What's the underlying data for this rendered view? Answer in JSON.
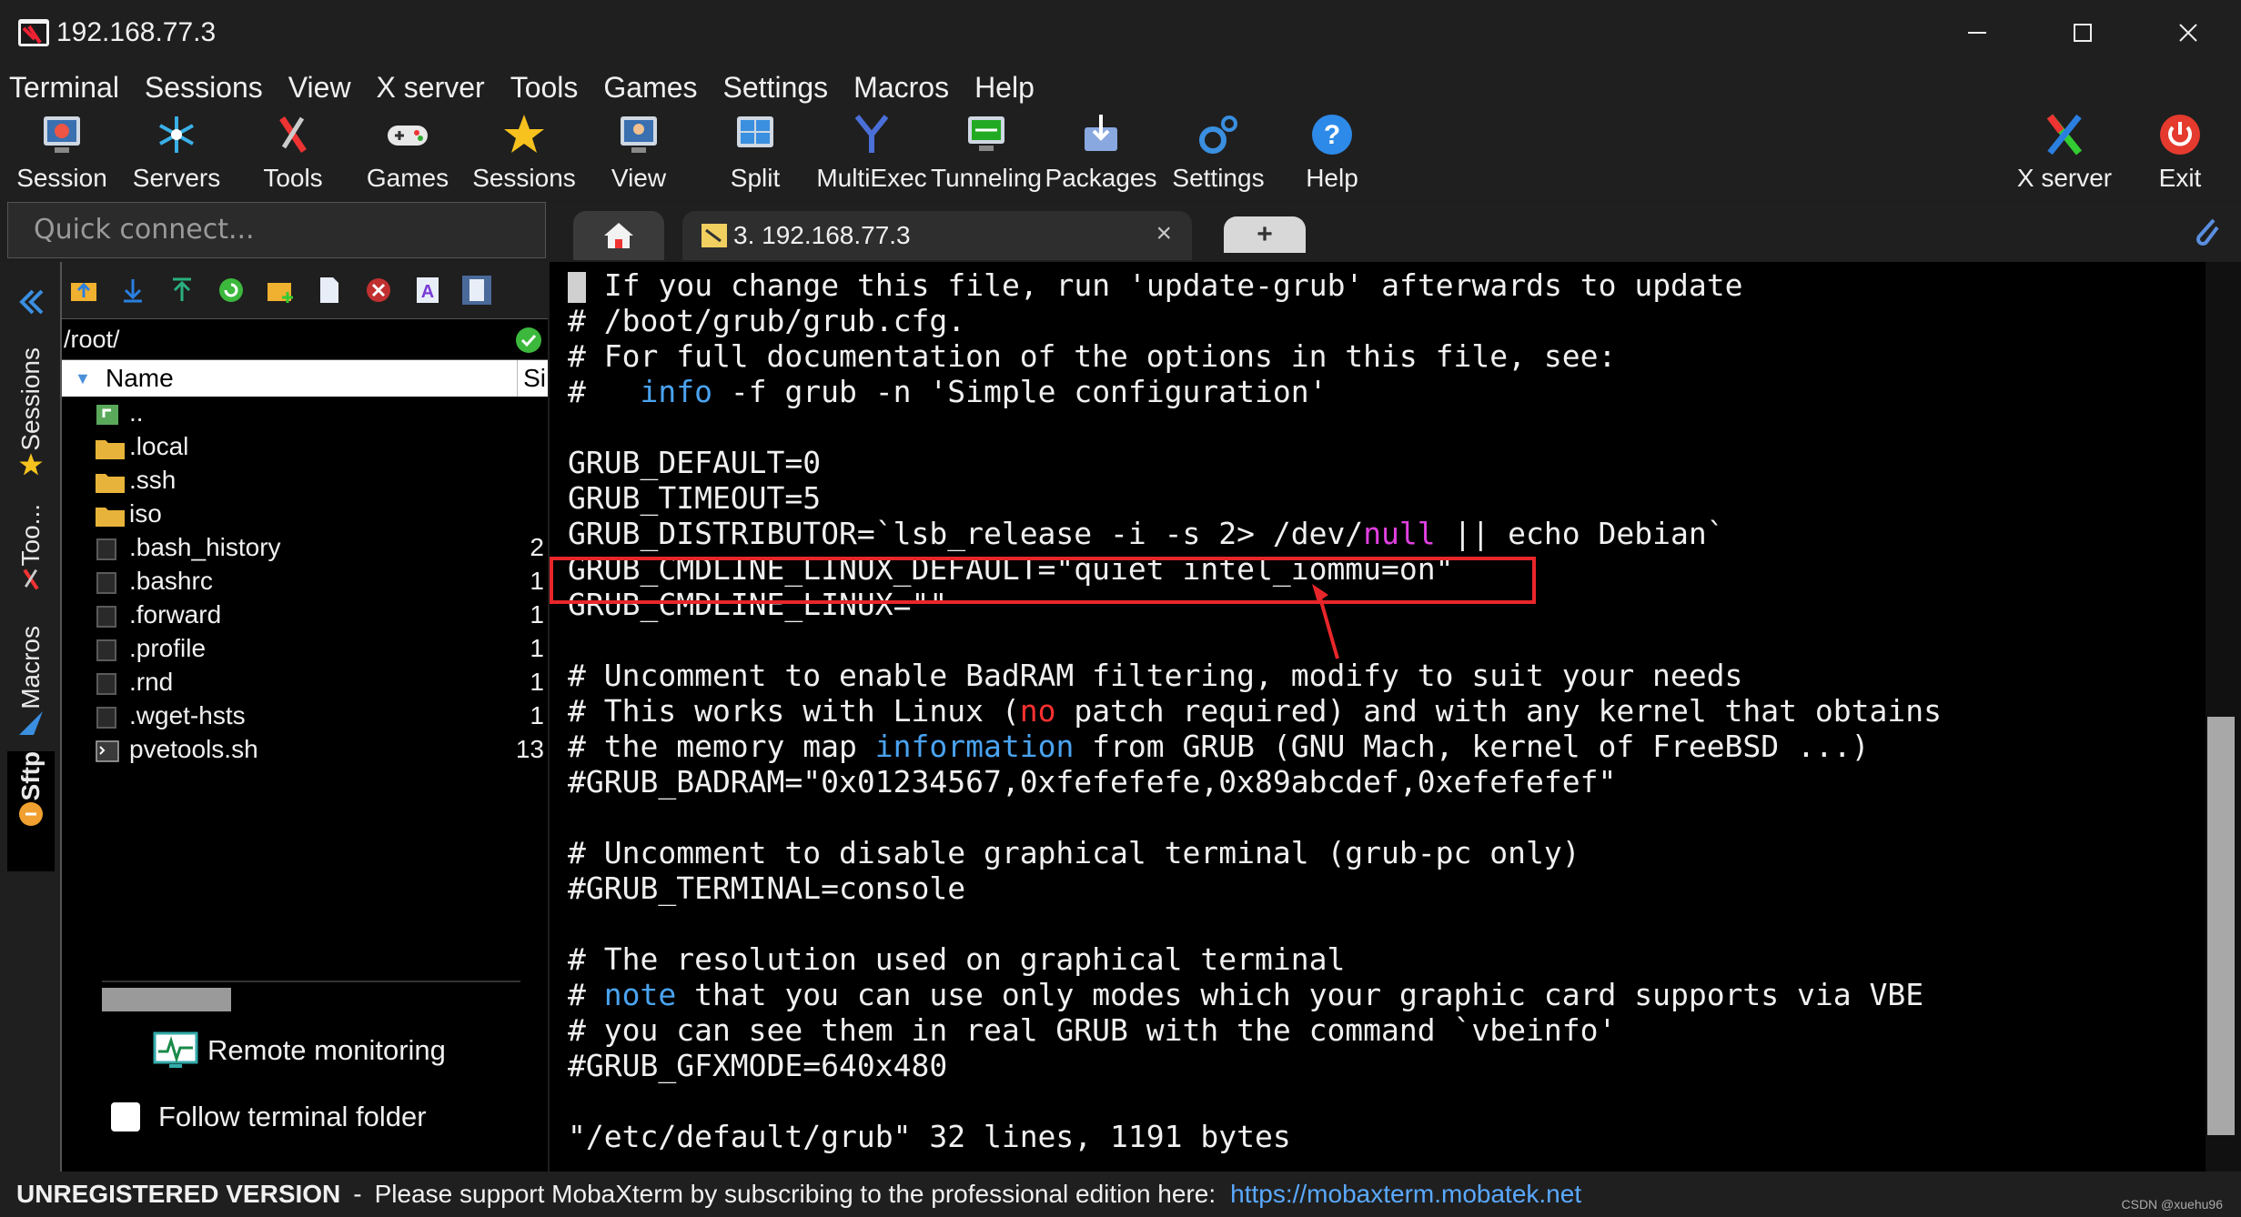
{
  "window": {
    "title": "192.168.77.3"
  },
  "menu": [
    "Terminal",
    "Sessions",
    "View",
    "X server",
    "Tools",
    "Games",
    "Settings",
    "Macros",
    "Help"
  ],
  "toolbar": {
    "items": [
      "Session",
      "Servers",
      "Tools",
      "Games",
      "Sessions",
      "View",
      "Split",
      "MultiExec",
      "Tunneling",
      "Packages",
      "Settings",
      "Help"
    ],
    "right_items": [
      "X server",
      "Exit"
    ]
  },
  "quick_connect": {
    "placeholder": "Quick connect..."
  },
  "tabs": {
    "session_label": "3. 192.168.77.3",
    "close": "×",
    "add": "+"
  },
  "side_tabs": [
    "Sessions",
    "Too...",
    "Macros",
    "Sftp"
  ],
  "sftp": {
    "path": "/root/",
    "header_name": "Name",
    "header_size": "Si",
    "files": [
      {
        "name": "..",
        "size": "",
        "icon": "parent-folder-icon"
      },
      {
        "name": ".local",
        "size": "",
        "icon": "folder-icon"
      },
      {
        "name": ".ssh",
        "size": "",
        "icon": "folder-icon"
      },
      {
        "name": "iso",
        "size": "",
        "icon": "folder-icon"
      },
      {
        "name": ".bash_history",
        "size": "2",
        "icon": "file-icon"
      },
      {
        "name": ".bashrc",
        "size": "1",
        "icon": "file-icon"
      },
      {
        "name": ".forward",
        "size": "1",
        "icon": "file-icon"
      },
      {
        "name": ".profile",
        "size": "1",
        "icon": "file-icon"
      },
      {
        "name": ".rnd",
        "size": "1",
        "icon": "file-icon"
      },
      {
        "name": ".wget-hsts",
        "size": "1",
        "icon": "file-icon"
      },
      {
        "name": "pvetools.sh",
        "size": "13",
        "icon": "script-icon"
      }
    ],
    "remote_monitoring": "Remote monitoring",
    "follow_terminal_folder": "Follow terminal folder"
  },
  "terminal": {
    "lines": [
      [
        {
          "t": "# If you change this file, run 'update-grub' afterwards to update"
        }
      ],
      [
        {
          "t": "# /boot/grub/grub.cfg."
        }
      ],
      [
        {
          "t": "# For full documentation of the options in this file, see:"
        }
      ],
      [
        {
          "t": "#   "
        },
        {
          "t": "info",
          "c": "kw-blue"
        },
        {
          "t": " -f grub -n 'Simple configuration'"
        }
      ],
      [
        {
          "t": ""
        }
      ],
      [
        {
          "t": "GRUB_DEFAULT=0"
        }
      ],
      [
        {
          "t": "GRUB_TIMEOUT=5"
        }
      ],
      [
        {
          "t": "GRUB_DISTRIBUTOR=`lsb_release -i -s 2> /dev/"
        },
        {
          "t": "null",
          "c": "kw-mag"
        },
        {
          "t": " || echo Debian`"
        }
      ],
      [
        {
          "t": "GRUB_CMDLINE_LINUX_DEFAULT=\"quiet intel_iommu=on\""
        }
      ],
      [
        {
          "t": "GRUB_CMDLINE_LINUX=\"\""
        }
      ],
      [
        {
          "t": ""
        }
      ],
      [
        {
          "t": "# Uncomment to enable BadRAM filtering, modify to suit your needs"
        }
      ],
      [
        {
          "t": "# This works with Linux ("
        },
        {
          "t": "no",
          "c": "kw-red"
        },
        {
          "t": " patch required) and with any kernel that obtains"
        }
      ],
      [
        {
          "t": "# the memory map "
        },
        {
          "t": "information",
          "c": "kw-blue"
        },
        {
          "t": " from GRUB (GNU Mach, kernel of FreeBSD ...)"
        }
      ],
      [
        {
          "t": "#GRUB_BADRAM=\"0x01234567,0xfefefefe,0x89abcdef,0xefefefef\""
        }
      ],
      [
        {
          "t": ""
        }
      ],
      [
        {
          "t": "# Uncomment to disable graphical terminal (grub-pc only)"
        }
      ],
      [
        {
          "t": "#GRUB_TERMINAL=console"
        }
      ],
      [
        {
          "t": ""
        }
      ],
      [
        {
          "t": "# The resolution used on graphical terminal"
        }
      ],
      [
        {
          "t": "# "
        },
        {
          "t": "note",
          "c": "kw-blue"
        },
        {
          "t": " that you can use only modes which your graphic card supports via VBE"
        }
      ],
      [
        {
          "t": "# you can see them in real GRUB with the command `vbeinfo'"
        }
      ],
      [
        {
          "t": "#GRUB_GFXMODE=640x480"
        }
      ],
      [
        {
          "t": ""
        }
      ],
      [
        {
          "t": "\"/etc/default/grub\" 32 lines, 1191 bytes"
        }
      ]
    ]
  },
  "statusbar": {
    "unregistered": "UNREGISTERED VERSION",
    "separator": "-",
    "message": "Please support MobaXterm by subscribing to the professional edition here:",
    "link": "https://mobaxterm.mobatek.net",
    "watermark": "CSDN @xuehu96"
  },
  "colors": {
    "highlight_box": "#e8262a",
    "link": "#5aa9ff",
    "keyword_blue": "#4aa3f0",
    "keyword_magenta": "#e040e0",
    "keyword_red": "#ff3030"
  }
}
